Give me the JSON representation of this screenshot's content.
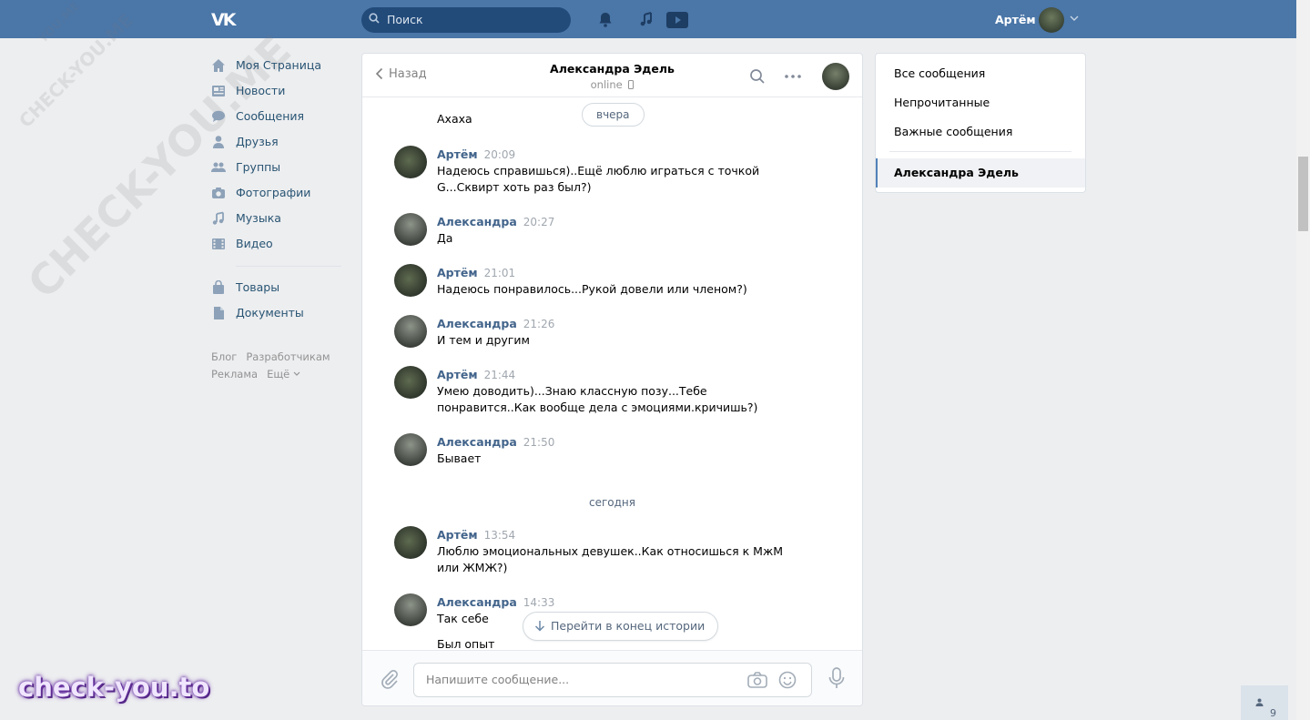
{
  "header": {
    "logo": "VK",
    "search_placeholder": "Поиск",
    "user_name": "Артём"
  },
  "sidebar": {
    "items": [
      {
        "label": "Моя Страница",
        "icon": "home-icon"
      },
      {
        "label": "Новости",
        "icon": "news-icon"
      },
      {
        "label": "Сообщения",
        "icon": "messages-icon"
      },
      {
        "label": "Друзья",
        "icon": "friend-icon"
      },
      {
        "label": "Группы",
        "icon": "groups-icon"
      },
      {
        "label": "Фотографии",
        "icon": "camera-icon"
      },
      {
        "label": "Музыка",
        "icon": "music-icon"
      },
      {
        "label": "Видео",
        "icon": "video-icon"
      }
    ],
    "items2": [
      {
        "label": "Товары",
        "icon": "bag-icon"
      },
      {
        "label": "Документы",
        "icon": "document-icon"
      }
    ],
    "footer": {
      "blog": "Блог",
      "dev": "Разработчикам",
      "ads": "Реклама",
      "more": "Ещё"
    }
  },
  "chat": {
    "back_label": "Назад",
    "peer_name": "Александра Эдель",
    "peer_status": "online",
    "partial_message": "Ахаха",
    "date_yesterday": "вчера",
    "date_today": "сегодня",
    "messages": [
      {
        "author": "Артём",
        "time": "20:09",
        "text": "Надеюсь справишься)..Ещё люблю играться с точкой G...Сквирт хоть раз был?)"
      },
      {
        "author": "Александра",
        "time": "20:27",
        "text": "Да"
      },
      {
        "author": "Артём",
        "time": "21:01",
        "text": "Надеюсь понравилось...Рукой довели или членом?)"
      },
      {
        "author": "Александра",
        "time": "21:26",
        "text": "И тем и другим"
      },
      {
        "author": "Артём",
        "time": "21:44",
        "text": "Умею доводить)...Знаю классную позу...Тебе понравится..Как вообще дела с эмоциями.кричишь?)"
      },
      {
        "author": "Александра",
        "time": "21:50",
        "text": "Бывает"
      },
      {
        "author": "Артём",
        "time": "13:54",
        "text": "Люблю эмоциональных девушек..Как относишься к МжМ или ЖМЖ?)"
      },
      {
        "author": "Александра",
        "time": "14:33",
        "text": "Так себе"
      }
    ],
    "trailing_message": "Был опыт",
    "jump_label": "Перейти в конец истории",
    "input_placeholder": "Напишите сообщение..."
  },
  "right_panel": {
    "items": [
      "Все сообщения",
      "Непрочитанные",
      "Важные сообщения"
    ],
    "active": "Александра Эдель"
  },
  "watermark": {
    "main": "check-you.to",
    "diag1": "CHECK-YOU.ME",
    "diag2": "CHECK-YOU.ME",
    "diag3": "YOU.ME"
  },
  "online_count": "9",
  "colors": {
    "header": "#4a76a8",
    "link": "#42648b",
    "background": "#edeef0"
  }
}
